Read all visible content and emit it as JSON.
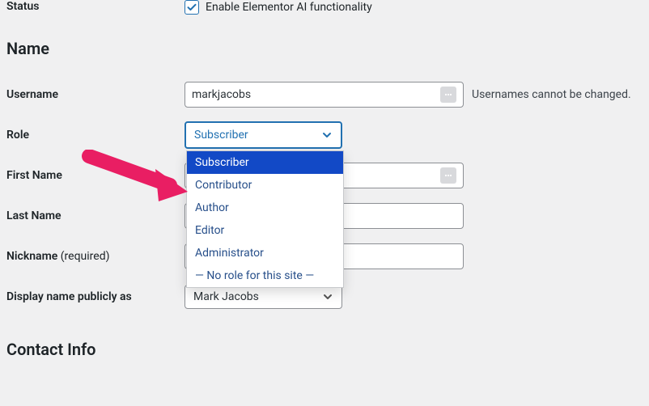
{
  "status": {
    "label": "Status",
    "checkbox_checked": true,
    "checkbox_label": "Enable Elementor AI functionality"
  },
  "sections": {
    "name": "Name",
    "contact": "Contact Info"
  },
  "username": {
    "label": "Username",
    "value": "markjacobs",
    "hint": "Usernames cannot be changed."
  },
  "role": {
    "label": "Role",
    "selected": "Subscriber",
    "options": [
      "Subscriber",
      "Contributor",
      "Author",
      "Editor",
      "Administrator",
      "— No role for this site —"
    ]
  },
  "first_name": {
    "label": "First Name",
    "value": ""
  },
  "last_name": {
    "label": "Last Name",
    "value": ""
  },
  "nickname": {
    "label": "Nickname",
    "required_text": "(required)",
    "value": "markjacobs"
  },
  "display_name": {
    "label": "Display name publicly as",
    "selected": "Mark Jacobs"
  }
}
